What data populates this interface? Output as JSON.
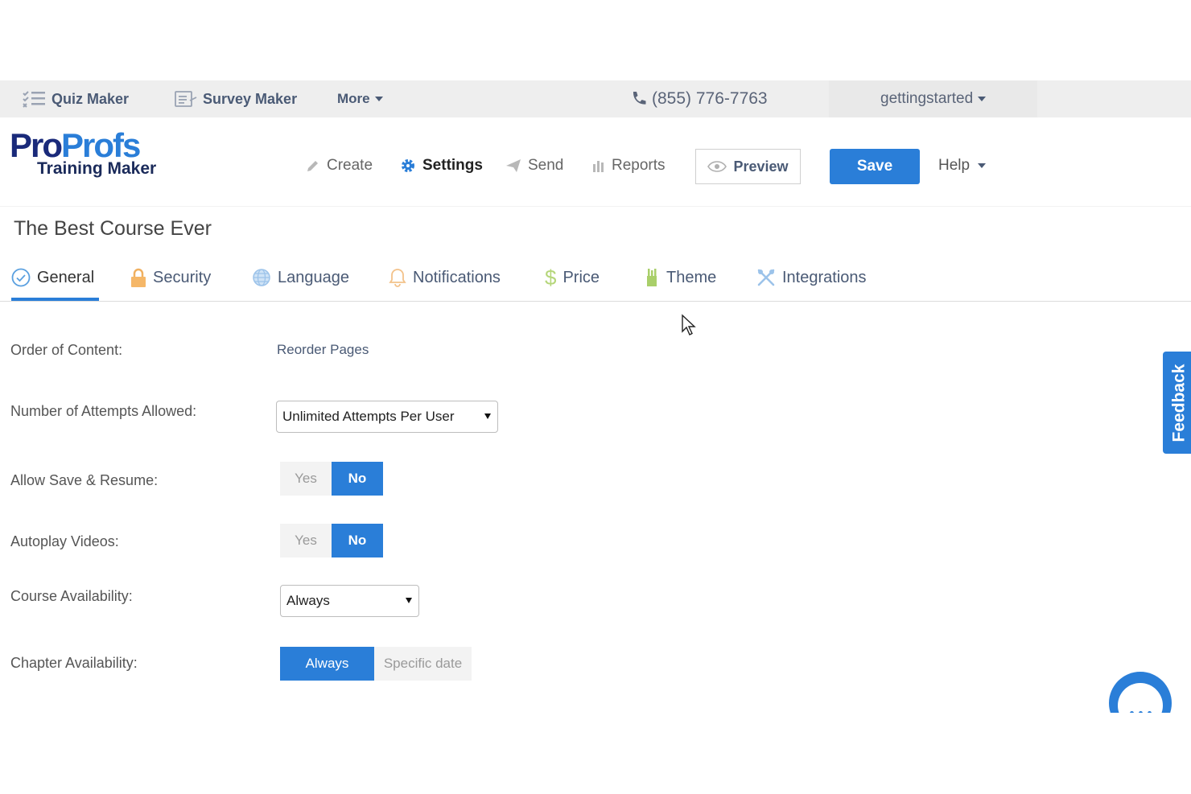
{
  "topbar": {
    "quiz_maker": "Quiz Maker",
    "survey_maker": "Survey Maker",
    "more": "More",
    "phone": "(855) 776-7763",
    "user": "gettingstarted"
  },
  "logo": {
    "pro_part1": "Pro",
    "pro_part2": "Profs",
    "product": "Training Maker"
  },
  "nav": {
    "create": "Create",
    "settings": "Settings",
    "send": "Send",
    "reports": "Reports",
    "preview": "Preview",
    "save": "Save",
    "help": "Help"
  },
  "course": {
    "title": "The Best Course Ever"
  },
  "tabs": {
    "general": "General",
    "security": "Security",
    "language": "Language",
    "notifications": "Notifications",
    "price": "Price",
    "theme": "Theme",
    "integrations": "Integrations"
  },
  "settings": {
    "order_label": "Order of Content:",
    "order_link": "Reorder Pages",
    "attempts_label": "Number of Attempts Allowed:",
    "attempts_value": "Unlimited Attempts Per User",
    "save_resume_label": "Allow Save & Resume:",
    "autoplay_label": "Autoplay Videos:",
    "yes": "Yes",
    "no": "No",
    "course_avail_label": "Course Availability:",
    "course_avail_value": "Always",
    "chapter_avail_label": "Chapter Availability:",
    "chapter_always": "Always",
    "chapter_specific": "Specific date"
  },
  "feedback": "Feedback",
  "colors": {
    "accent": "#2a7ed8",
    "brand_dark": "#1a2a7a"
  }
}
